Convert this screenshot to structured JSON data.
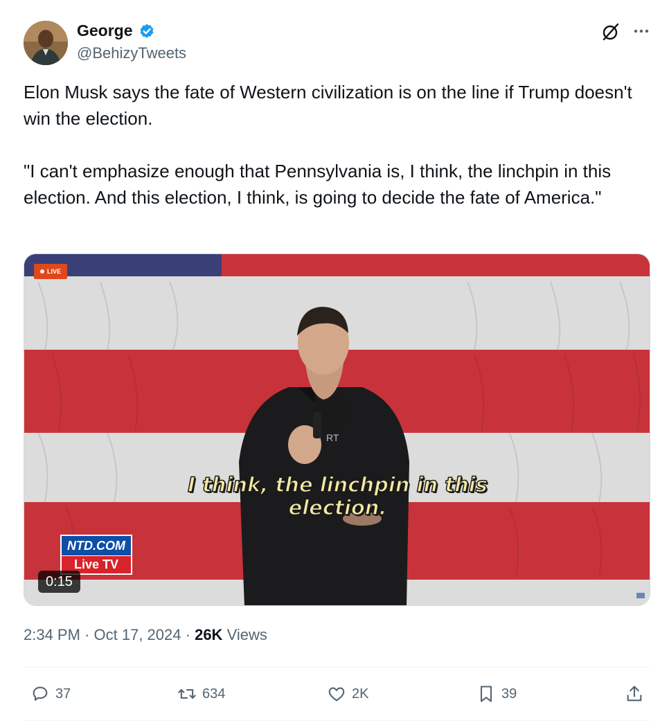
{
  "author": {
    "name": "George",
    "handle": "@BehizyTweets",
    "verified": true,
    "badge_color": "#1d9bf0"
  },
  "icons": {
    "verified": "verified-badge-icon",
    "grok": "grok-icon",
    "more": "more-options-icon",
    "reply": "reply-icon",
    "retweet": "retweet-icon",
    "like": "like-icon",
    "bookmark": "bookmark-icon",
    "share": "share-icon"
  },
  "tweet": {
    "paragraphs": [
      "Elon Musk says the fate of Western civilization is on the line if Trump doesn't win the election.",
      "\"I can't emphasize enough that Pennsylvania is, I think, the linchpin in this election. And this election, I think, is going to decide the fate of America.\""
    ]
  },
  "media": {
    "live_label": "LIVE",
    "caption_line1": "I think, the linchpin in this",
    "caption_line2": "election.",
    "ntd_top": "NTD.COM",
    "ntd_bottom": "Live TV",
    "duration": "0:15",
    "shirt_text": "RT"
  },
  "meta": {
    "time": "2:34 PM",
    "separator": "·",
    "date": "Oct 17, 2024",
    "views_count": "26K",
    "views_label": "Views"
  },
  "actions": {
    "replies": "37",
    "retweets": "634",
    "likes": "2K",
    "bookmarks": "39"
  },
  "colors": {
    "text_primary": "#0f1419",
    "text_secondary": "#536471",
    "verified_blue": "#1d9bf0",
    "flag_red": "#c8333b",
    "flag_white": "#dcdcdc",
    "flag_blue": "#3a3f78"
  }
}
